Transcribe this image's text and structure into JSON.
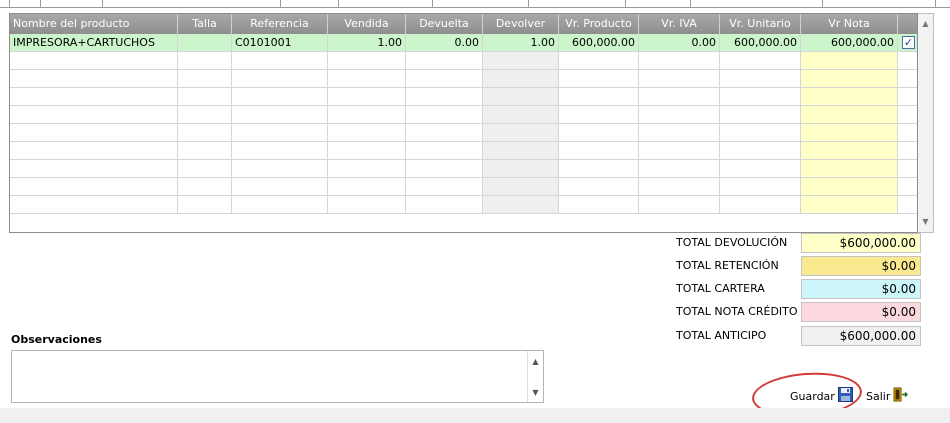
{
  "grid": {
    "columns": [
      {
        "key": "nombre",
        "label": "Nombre del producto"
      },
      {
        "key": "talla",
        "label": "Talla"
      },
      {
        "key": "referencia",
        "label": "Referencia"
      },
      {
        "key": "vendida",
        "label": "Vendida"
      },
      {
        "key": "devuelta",
        "label": "Devuelta"
      },
      {
        "key": "devolver",
        "label": "Devolver"
      },
      {
        "key": "vr_producto",
        "label": "Vr. Producto"
      },
      {
        "key": "vr_iva",
        "label": "Vr. IVA"
      },
      {
        "key": "vr_unitario",
        "label": "Vr. Unitario"
      },
      {
        "key": "vr_nota",
        "label": "Vr Nota"
      },
      {
        "key": "check",
        "label": ""
      }
    ],
    "rows": [
      {
        "nombre": "IMPRESORA+CARTUCHOS",
        "talla": "",
        "referencia": "C0101001",
        "vendida": "1.00",
        "devuelta": "0.00",
        "devolver": "1.00",
        "vr_producto": "600,000.00",
        "vr_iva": "0.00",
        "vr_unitario": "600,000.00",
        "vr_nota": "600,000.00",
        "checked": true
      }
    ],
    "empty_rows": 9
  },
  "totals": {
    "devolucion": {
      "label": "TOTAL DEVOLUCIÓN",
      "value": "$600,000.00",
      "color": "#ffffc8"
    },
    "retencion": {
      "label": "TOTAL RETENCIÓN",
      "value": "$0.00",
      "color": "#fbe990"
    },
    "cartera": {
      "label": "TOTAL CARTERA",
      "value": "$0.00",
      "color": "#ccf6fa"
    },
    "nota_credito": {
      "label": "TOTAL NOTA CRÉDITO",
      "value": "$0.00",
      "color": "#fbd9de"
    },
    "anticipo": {
      "label": "TOTAL ANTICIPO",
      "value": "$600,000.00",
      "color": "#f0f0f0"
    }
  },
  "observaciones": {
    "label": "Observaciones",
    "value": ""
  },
  "actions": {
    "guardar": {
      "label": "Guardar",
      "icon": "floppy-disk-icon"
    },
    "salir": {
      "label": "Salir",
      "icon": "exit-door-icon"
    }
  }
}
